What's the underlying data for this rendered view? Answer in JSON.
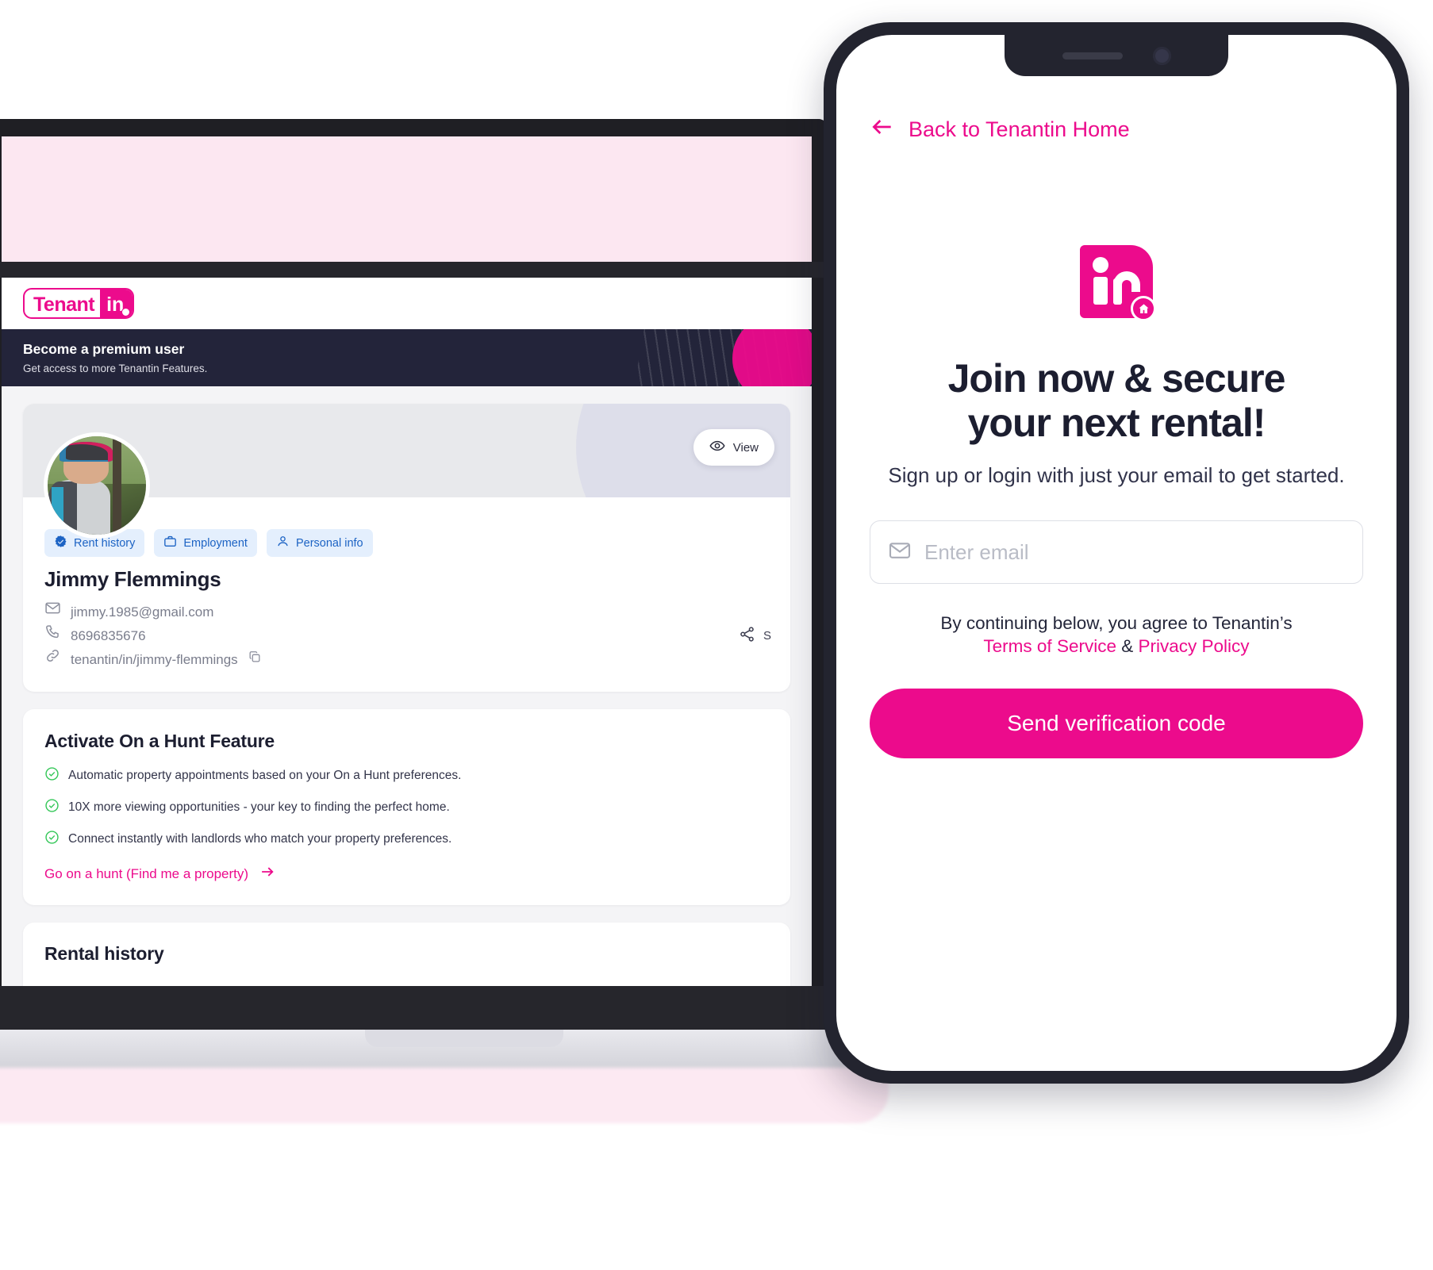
{
  "desktop": {
    "logo": {
      "word": "Tenant",
      "mark": "in",
      "registered": "®"
    },
    "premium_banner": {
      "title": "Become a premium user",
      "subtitle": "Get access to more Tenantin Features."
    },
    "profile": {
      "view_button_label": "View",
      "share_button_label": "S",
      "chips": [
        {
          "label": "Rent history",
          "icon": "verified-badge-icon"
        },
        {
          "label": "Employment",
          "icon": "briefcase-icon"
        },
        {
          "label": "Personal info",
          "icon": "person-icon"
        }
      ],
      "name": "Jimmy Flemmings",
      "email": "jimmy.1985@gmail.com",
      "phone": "8696835676",
      "profile_link": "tenantin/in/jimmy-flemmings",
      "copy_icon": "copy-icon"
    },
    "hunt": {
      "title": "Activate On a Hunt Feature",
      "items": [
        "Automatic property appointments based on your On a Hunt preferences.",
        "10X more viewing opportunities - your key to finding the perfect home.",
        "Connect instantly with landlords who match your property preferences."
      ],
      "cta": "Go on a hunt (Find me a property)"
    },
    "rental_history": {
      "title": "Rental history"
    }
  },
  "phone": {
    "back_link": "Back to Tenantin Home",
    "headline_line1": "Join now & secure",
    "headline_line2": "your next rental!",
    "subheadline": "Sign up or login with just your email to get started.",
    "email_input": {
      "value": "",
      "placeholder": "Enter email"
    },
    "terms": {
      "prefix": "By continuing below, you agree to Tenantin’s",
      "terms_label": "Terms of Service",
      "separator": "&",
      "privacy_label": "Privacy Policy"
    },
    "submit_label": "Send verification code"
  },
  "colors": {
    "brand_pink": "#ec0b8c",
    "dark_navy": "#23243a",
    "chip_blue_bg": "#e4effd",
    "chip_blue_text": "#1c63c4",
    "check_green": "#35c759"
  }
}
